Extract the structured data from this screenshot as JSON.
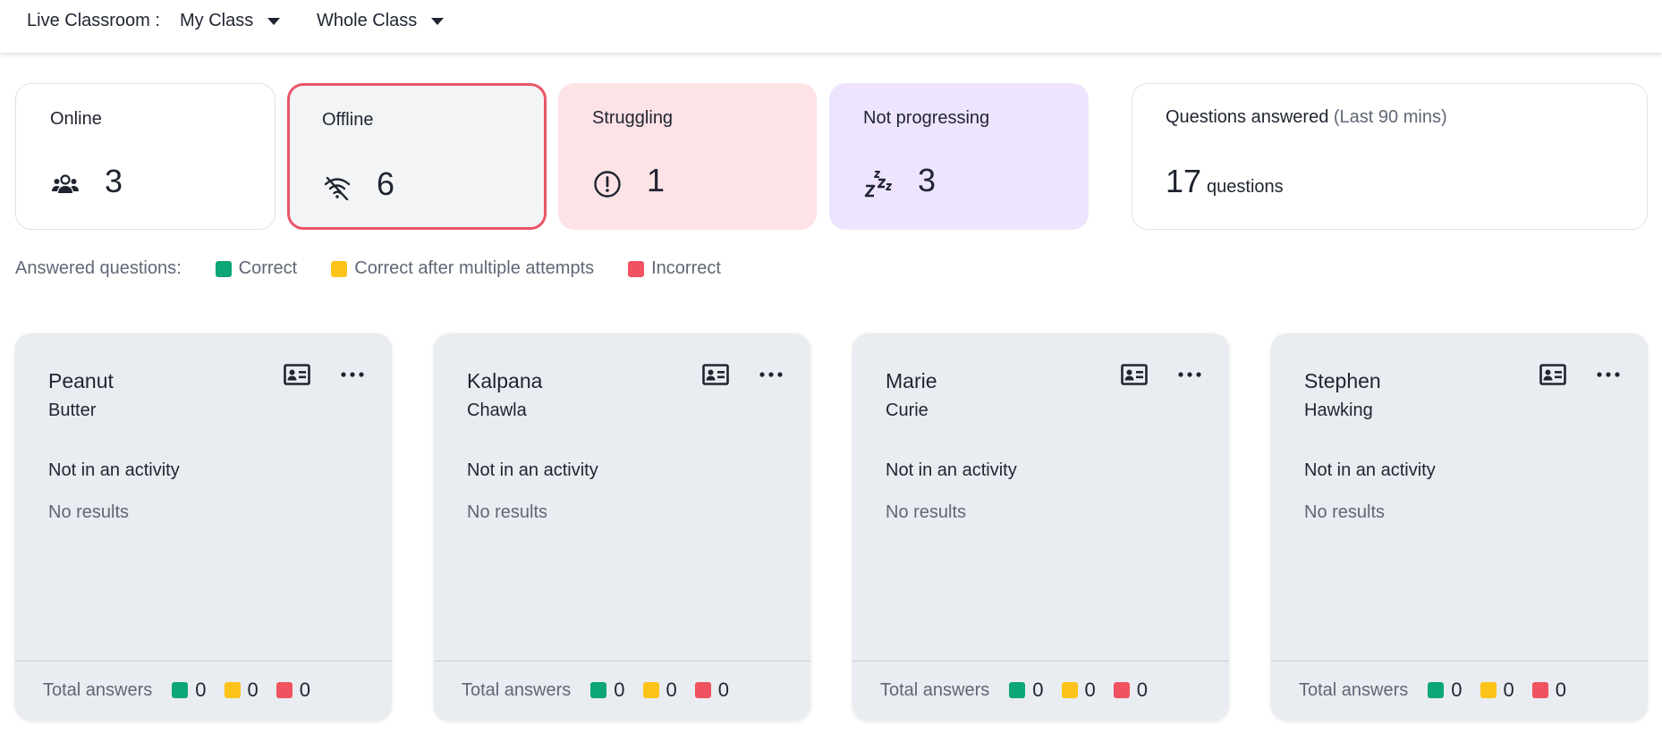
{
  "topbar": {
    "label": "Live Classroom :",
    "class_dropdown": "My Class",
    "group_dropdown": "Whole Class"
  },
  "stats": {
    "online": {
      "title": "Online",
      "count": "3",
      "icon": "people-icon"
    },
    "offline": {
      "title": "Offline",
      "count": "6",
      "icon": "wifi-off-icon"
    },
    "struggling": {
      "title": "Struggling",
      "count": "1",
      "icon": "alert-circle-icon"
    },
    "not_progressing": {
      "title": "Not progressing",
      "count": "3",
      "icon": "sleep-icon"
    },
    "answered": {
      "title": "Questions answered",
      "subtitle": "(Last 90 mins)",
      "count": "17",
      "unit": "questions"
    }
  },
  "legend": {
    "label": "Answered questions:",
    "items": [
      {
        "label": "Correct",
        "color": "#0ca678"
      },
      {
        "label": "Correct after multiple attempts",
        "color": "#fcc419"
      },
      {
        "label": "Incorrect",
        "color": "#f0525f"
      }
    ]
  },
  "students": [
    {
      "first": "Peanut",
      "last": "Butter",
      "activity": "Not in an activity",
      "results": "No results",
      "total_label": "Total answers",
      "correct": "0",
      "multi": "0",
      "incorrect": "0"
    },
    {
      "first": "Kalpana",
      "last": "Chawla",
      "activity": "Not in an activity",
      "results": "No results",
      "total_label": "Total answers",
      "correct": "0",
      "multi": "0",
      "incorrect": "0"
    },
    {
      "first": "Marie",
      "last": "Curie",
      "activity": "Not in an activity",
      "results": "No results",
      "total_label": "Total answers",
      "correct": "0",
      "multi": "0",
      "incorrect": "0"
    },
    {
      "first": "Stephen",
      "last": "Hawking",
      "activity": "Not in an activity",
      "results": "No results",
      "total_label": "Total answers",
      "correct": "0",
      "multi": "0",
      "incorrect": "0"
    }
  ]
}
